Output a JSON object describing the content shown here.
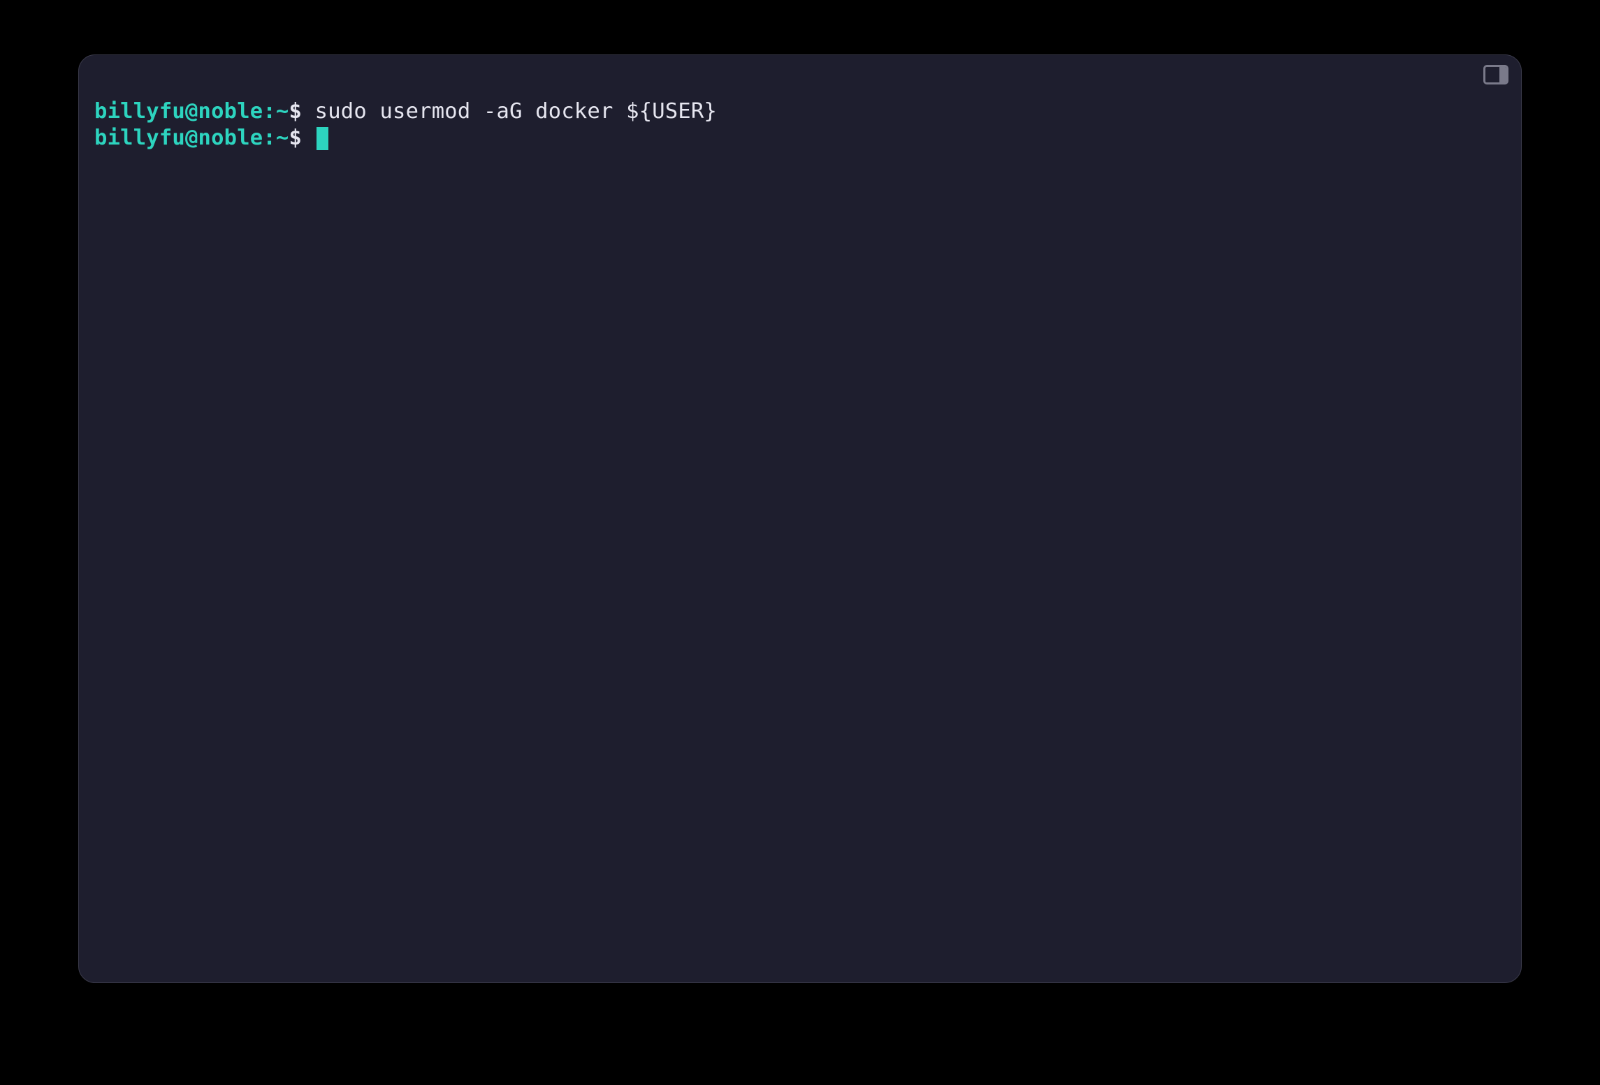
{
  "terminal": {
    "lines": [
      {
        "userhost": "billyfu@noble",
        "sep": ":",
        "path": "~",
        "dollar": "$",
        "command": " sudo usermod -aG docker ${USER}"
      },
      {
        "userhost": "billyfu@noble",
        "sep": ":",
        "path": "~",
        "dollar": "$",
        "command": " "
      }
    ]
  },
  "colors": {
    "background": "#1e1e2e",
    "accent": "#2dd4bf",
    "text": "#e6e6f0"
  }
}
